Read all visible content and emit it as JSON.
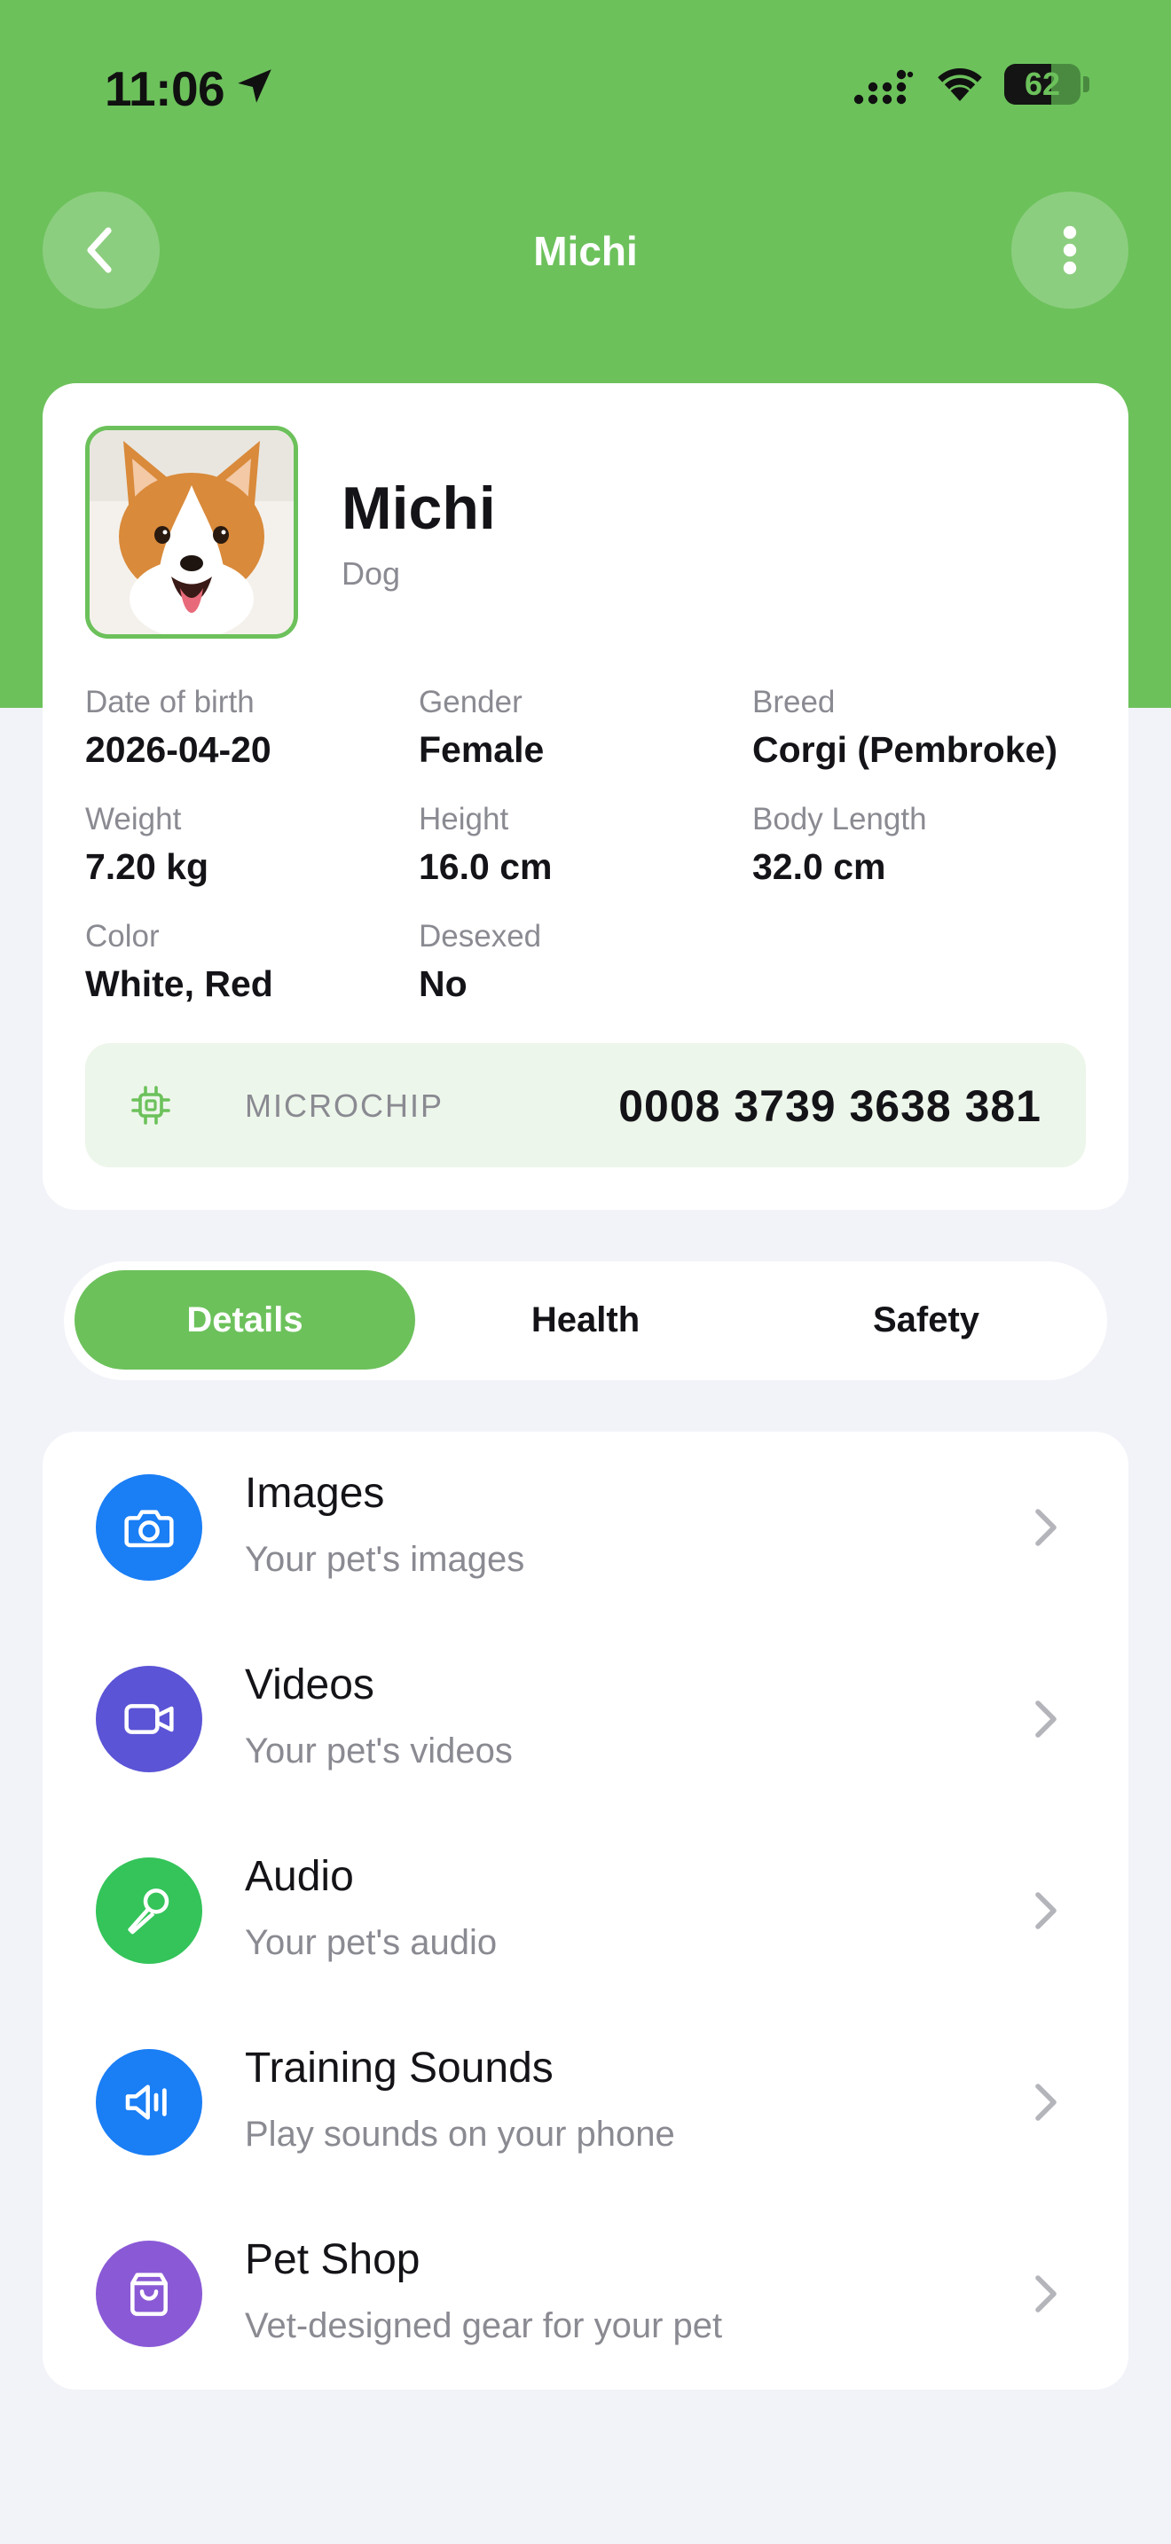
{
  "status_bar": {
    "time": "11:06",
    "battery_level": "62",
    "battery_fraction": 0.62
  },
  "nav": {
    "title": "Michi",
    "back_icon": "chevron-left-icon",
    "more_icon": "vertical-ellipsis-icon"
  },
  "profile": {
    "name": "Michi",
    "species": "Dog",
    "attributes": [
      {
        "label": "Date of birth",
        "value": "2026-04-20"
      },
      {
        "label": "Gender",
        "value": "Female"
      },
      {
        "label": "Breed",
        "value": "Corgi (Pembroke)"
      },
      {
        "label": "Weight",
        "value": "7.20 kg"
      },
      {
        "label": "Height",
        "value": "16.0 cm"
      },
      {
        "label": "Body Length",
        "value": "32.0 cm"
      },
      {
        "label": "Color",
        "value": "White, Red"
      },
      {
        "label": "Desexed",
        "value": "No"
      }
    ],
    "microchip": {
      "label": "MICROCHIP",
      "number": "0008 3739 3638 381",
      "icon": "chip-icon"
    }
  },
  "tabs": [
    {
      "label": "Details",
      "active": true
    },
    {
      "label": "Health",
      "active": false
    },
    {
      "label": "Safety",
      "active": false
    }
  ],
  "menu": [
    {
      "title": "Images",
      "subtitle": "Your pet's images",
      "icon": "camera-icon",
      "color": "#1a7ef5"
    },
    {
      "title": "Videos",
      "subtitle": "Your pet's videos",
      "icon": "video-camera-icon",
      "color": "#5b54d6"
    },
    {
      "title": "Audio",
      "subtitle": "Your pet's audio",
      "icon": "microphone-icon",
      "color": "#34c45a"
    },
    {
      "title": "Training Sounds",
      "subtitle": "Play sounds on your phone",
      "icon": "speaker-icon",
      "color": "#1a7ef5"
    },
    {
      "title": "Pet Shop",
      "subtitle": "Vet-designed gear for your pet",
      "icon": "shopping-bag-icon",
      "color": "#8a5ad6"
    }
  ],
  "colors": {
    "brand_green": "#6cc15b",
    "background": "#f2f3f8",
    "microchip_bg": "#edf6ea",
    "secondary_text": "#8a8a92"
  }
}
